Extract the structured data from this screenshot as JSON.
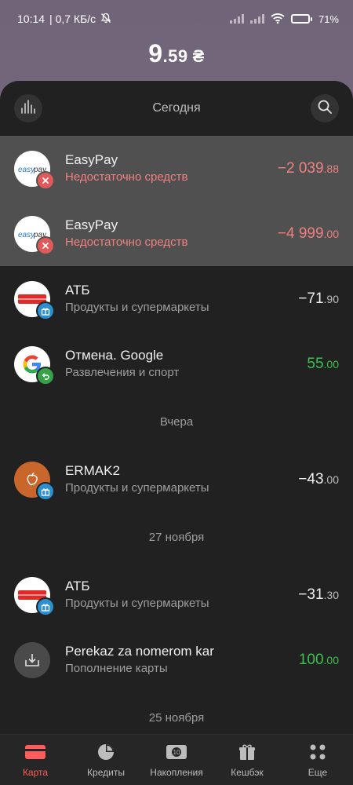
{
  "status_bar": {
    "time": "10:14",
    "net_speed": "| 0,7 КБ/с",
    "battery": "71%"
  },
  "balance": {
    "whole": "9",
    "cents": ".59",
    "currency": "₴"
  },
  "header": {
    "date": "Сегодня",
    "stats_icon": "bar-stats-icon",
    "search_icon": "search-icon"
  },
  "transactions": [
    {
      "title": "EasyPay",
      "subtitle": "Недостаточно средств",
      "amount_main": "−2 039",
      "amount_cents": ".88",
      "status": "declined",
      "logo": "easypay"
    },
    {
      "title": "EasyPay",
      "subtitle": "Недостаточно средств",
      "amount_main": "−4 999",
      "amount_cents": ".00",
      "status": "declined",
      "logo": "easypay"
    },
    {
      "title": "АТБ",
      "subtitle": "Продукты и супермаркеты",
      "amount_main": "−71",
      "amount_cents": ".90",
      "status": "ok",
      "logo": "atb"
    },
    {
      "title": "Отмена. Google",
      "subtitle": "Развлечения и спорт",
      "amount_main": "55",
      "amount_cents": ".00",
      "status": "refund",
      "logo": "google"
    }
  ],
  "separators": {
    "yesterday": "Вчера",
    "nov27": "27 ноября",
    "nov25": "25 ноября"
  },
  "transactions_yesterday": [
    {
      "title": "ERMAK2",
      "subtitle": "Продукты и супермаркеты",
      "amount_main": "−43",
      "amount_cents": ".00",
      "logo": "apple"
    }
  ],
  "transactions_nov27": [
    {
      "title": "АТБ",
      "subtitle": "Продукты и супермаркеты",
      "amount_main": "−31",
      "amount_cents": ".30",
      "logo": "atb"
    },
    {
      "title": "Perekaz za nomerom kar",
      "subtitle": "Пополнение карты",
      "amount_main": "100",
      "amount_cents": ".00",
      "logo": "topup"
    }
  ],
  "nav": [
    {
      "label": "Карта",
      "icon": "card-icon",
      "active": true
    },
    {
      "label": "Кредиты",
      "icon": "pie-chart-icon",
      "active": false
    },
    {
      "label": "Накопления",
      "icon": "savings-icon",
      "active": false
    },
    {
      "label": "Кешбэк",
      "icon": "gift-icon",
      "active": false
    },
    {
      "label": "Еще",
      "icon": "more-icon",
      "active": false
    }
  ],
  "colors": {
    "accent": "#ff5c5c",
    "error": "#f08080",
    "positive": "#3cc24f",
    "sheet_bg": "#212121"
  }
}
